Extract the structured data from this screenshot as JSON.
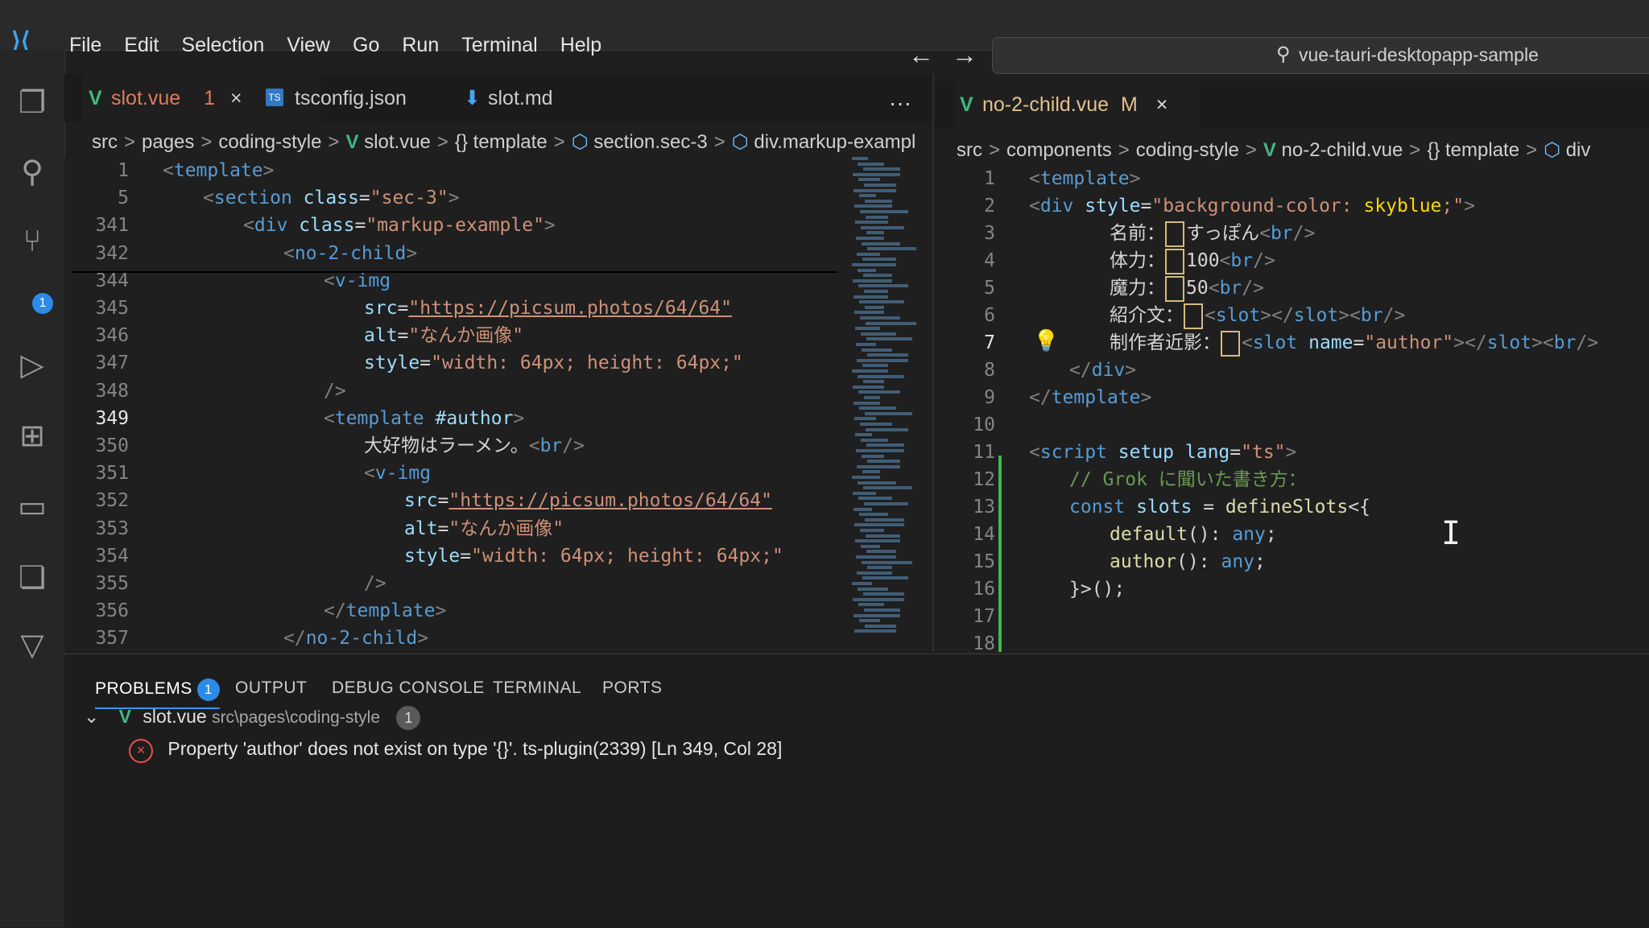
{
  "menu": [
    "File",
    "Edit",
    "Selection",
    "View",
    "Go",
    "Run",
    "Terminal",
    "Help"
  ],
  "nav": {
    "back": "←",
    "forward": "→"
  },
  "search": {
    "text": "vue-tauri-desktopapp-sample"
  },
  "left_tabs": [
    {
      "label": "slot.vue",
      "badge": "1",
      "close": "×",
      "icon": "V"
    },
    {
      "label": "tsconfig.json",
      "icon": "TS"
    },
    {
      "label": "slot.md",
      "icon": "⬇"
    }
  ],
  "more": "···",
  "left_breadcrumb": [
    "src",
    "pages",
    "coding-style",
    "slot.vue",
    "{} template",
    "section.sec-3",
    "div.markup-exampl"
  ],
  "right_tab": {
    "label": "no-2-child.vue",
    "status": "M",
    "close": "×",
    "icon": "V"
  },
  "right_breadcrumb": [
    "src",
    "components",
    "coding-style",
    "no-2-child.vue",
    "{} template",
    "div"
  ],
  "left_lines": [
    {
      "n": "1",
      "ind": 0,
      "segs": [
        [
          "p",
          "<"
        ],
        [
          "t",
          "template"
        ],
        [
          "p",
          ">"
        ]
      ]
    },
    {
      "n": "5",
      "ind": 1,
      "segs": [
        [
          "p",
          "<"
        ],
        [
          "t",
          "section "
        ],
        [
          "a",
          "class"
        ],
        [
          "w",
          "="
        ],
        [
          "s",
          "\"sec-3\""
        ],
        [
          "p",
          ">"
        ]
      ]
    },
    {
      "n": "341",
      "ind": 2,
      "segs": [
        [
          "p",
          "<"
        ],
        [
          "t",
          "div "
        ],
        [
          "a",
          "class"
        ],
        [
          "w",
          "="
        ],
        [
          "s",
          "\"markup-example\""
        ],
        [
          "p",
          ">"
        ]
      ]
    },
    {
      "n": "342",
      "ind": 3,
      "segs": [
        [
          "p",
          "<"
        ],
        [
          "t",
          "no-2-child"
        ],
        [
          "p",
          ">"
        ]
      ]
    },
    {
      "n": "344",
      "ind": 4,
      "segs": [
        [
          "p",
          "<"
        ],
        [
          "t",
          "v-img"
        ]
      ]
    },
    {
      "n": "345",
      "ind": 5,
      "segs": [
        [
          "a",
          "src"
        ],
        [
          "w",
          "="
        ],
        [
          "s",
          "\"https://picsum.photos/64/64\""
        ]
      ]
    },
    {
      "n": "346",
      "ind": 5,
      "segs": [
        [
          "a",
          "alt"
        ],
        [
          "w",
          "="
        ],
        [
          "s",
          "\"なんか画像\""
        ]
      ]
    },
    {
      "n": "347",
      "ind": 5,
      "segs": [
        [
          "a",
          "style"
        ],
        [
          "w",
          "="
        ],
        [
          "s",
          "\"width: 64px; height: 64px;\""
        ]
      ]
    },
    {
      "n": "348",
      "ind": 4,
      "segs": [
        [
          "p",
          "/>"
        ]
      ]
    },
    {
      "n": "349",
      "ind": 4,
      "segs": [
        [
          "p",
          "<"
        ],
        [
          "t",
          "template "
        ],
        [
          "a",
          "#author"
        ],
        [
          "p",
          ">"
        ]
      ]
    },
    {
      "n": "350",
      "ind": 5,
      "segs": [
        [
          "w",
          "大好物はラーメン。"
        ],
        [
          "p",
          "<"
        ],
        [
          "t",
          "br"
        ],
        [
          "p",
          "/>"
        ]
      ]
    },
    {
      "n": "351",
      "ind": 5,
      "segs": [
        [
          "p",
          "<"
        ],
        [
          "t",
          "v-img"
        ]
      ]
    },
    {
      "n": "352",
      "ind": 6,
      "segs": [
        [
          "a",
          "src"
        ],
        [
          "w",
          "="
        ],
        [
          "s",
          "\"https://picsum.photos/64/64\""
        ]
      ]
    },
    {
      "n": "353",
      "ind": 6,
      "segs": [
        [
          "a",
          "alt"
        ],
        [
          "w",
          "="
        ],
        [
          "s",
          "\"なんか画像\""
        ]
      ]
    },
    {
      "n": "354",
      "ind": 6,
      "segs": [
        [
          "a",
          "style"
        ],
        [
          "w",
          "="
        ],
        [
          "s",
          "\"width: 64px; height: 64px;\""
        ]
      ]
    },
    {
      "n": "355",
      "ind": 5,
      "segs": [
        [
          "p",
          "/>"
        ]
      ]
    },
    {
      "n": "356",
      "ind": 4,
      "segs": [
        [
          "p",
          "</"
        ],
        [
          "t",
          "template"
        ],
        [
          "p",
          ">"
        ]
      ]
    },
    {
      "n": "357",
      "ind": 3,
      "segs": [
        [
          "p",
          "</"
        ],
        [
          "t",
          "no-2-child"
        ],
        [
          "p",
          ">"
        ]
      ]
    }
  ],
  "right_lines": [
    {
      "n": "1",
      "ind": 0,
      "segs": [
        [
          "p",
          "<"
        ],
        [
          "t",
          "template"
        ],
        [
          "p",
          ">"
        ]
      ]
    },
    {
      "n": "2",
      "ind": 0,
      "segs": [
        [
          "p",
          "<"
        ],
        [
          "t",
          "div "
        ],
        [
          "a",
          "style"
        ],
        [
          "w",
          "="
        ],
        [
          "s",
          "\"background-color: "
        ],
        [
          "y",
          "skyblue"
        ],
        [
          "s",
          ";\""
        ],
        [
          "p",
          ">"
        ]
      ]
    },
    {
      "n": "3",
      "ind": 2,
      "segs": [
        [
          "w",
          "名前："
        ],
        [
          "box",
          ""
        ],
        [
          "w",
          "すっぽん"
        ],
        [
          "p",
          "<"
        ],
        [
          "t",
          "br"
        ],
        [
          "p",
          "/>"
        ]
      ]
    },
    {
      "n": "4",
      "ind": 2,
      "segs": [
        [
          "w",
          "体力："
        ],
        [
          "box",
          ""
        ],
        [
          "w",
          "100"
        ],
        [
          "p",
          "<"
        ],
        [
          "t",
          "br"
        ],
        [
          "p",
          "/>"
        ]
      ]
    },
    {
      "n": "5",
      "ind": 2,
      "segs": [
        [
          "w",
          "魔力："
        ],
        [
          "box",
          ""
        ],
        [
          "w",
          "50"
        ],
        [
          "p",
          "<"
        ],
        [
          "t",
          "br"
        ],
        [
          "p",
          "/>"
        ]
      ]
    },
    {
      "n": "6",
      "ind": 2,
      "segs": [
        [
          "w",
          "紹介文："
        ],
        [
          "box",
          ""
        ],
        [
          "p",
          "<"
        ],
        [
          "t",
          "slot"
        ],
        [
          "p",
          "></"
        ],
        [
          "t",
          "slot"
        ],
        [
          "p",
          "><"
        ],
        [
          "t",
          "br"
        ],
        [
          "p",
          "/>"
        ]
      ]
    },
    {
      "n": "7",
      "ind": 2,
      "segs": [
        [
          "w",
          "制作者近影："
        ],
        [
          "box",
          ""
        ],
        [
          "p",
          "<"
        ],
        [
          "t",
          "slot "
        ],
        [
          "a",
          "name"
        ],
        [
          "w",
          "="
        ],
        [
          "s",
          "\"author\""
        ],
        [
          "p",
          "></"
        ],
        [
          "t",
          "slot"
        ],
        [
          "p",
          "><"
        ],
        [
          "t",
          "br"
        ],
        [
          "p",
          "/>"
        ]
      ]
    },
    {
      "n": "8",
      "ind": 1,
      "segs": [
        [
          "p",
          "</"
        ],
        [
          "t",
          "div"
        ],
        [
          "p",
          ">"
        ]
      ]
    },
    {
      "n": "9",
      "ind": 0,
      "segs": [
        [
          "p",
          "</"
        ],
        [
          "t",
          "template"
        ],
        [
          "p",
          ">"
        ]
      ]
    },
    {
      "n": "10",
      "ind": 0,
      "segs": []
    },
    {
      "n": "11",
      "ind": 0,
      "segs": [
        [
          "p",
          "<"
        ],
        [
          "t",
          "script "
        ],
        [
          "a",
          "setup "
        ],
        [
          "a",
          "lang"
        ],
        [
          "w",
          "="
        ],
        [
          "s",
          "\"ts\""
        ],
        [
          "p",
          ">"
        ]
      ]
    },
    {
      "n": "12",
      "ind": 1,
      "segs": [
        [
          "c",
          "// Grok に聞いた書き方："
        ]
      ]
    },
    {
      "n": "13",
      "ind": 1,
      "segs": [
        [
          "k",
          "const "
        ],
        [
          "a",
          "slots"
        ],
        [
          "w",
          " = "
        ],
        [
          "f",
          "defineSlots"
        ],
        [
          "w",
          "<{"
        ]
      ]
    },
    {
      "n": "14",
      "ind": 2,
      "segs": [
        [
          "f",
          "default"
        ],
        [
          "w",
          "(): "
        ],
        [
          "k",
          "any"
        ],
        [
          "w",
          ";"
        ]
      ]
    },
    {
      "n": "15",
      "ind": 2,
      "segs": [
        [
          "f",
          "author"
        ],
        [
          "w",
          "(): "
        ],
        [
          "k",
          "any"
        ],
        [
          "w",
          ";"
        ]
      ]
    },
    {
      "n": "16",
      "ind": 1,
      "segs": [
        [
          "w",
          "}>();"
        ]
      ]
    },
    {
      "n": "17",
      "ind": 0,
      "segs": []
    },
    {
      "n": "18",
      "ind": 0,
      "segs": []
    }
  ],
  "panel": {
    "tabs": [
      "PROBLEMS",
      "OUTPUT",
      "DEBUG CONSOLE",
      "TERMINAL",
      "PORTS"
    ],
    "problems_count": "1",
    "file": {
      "name": "slot.vue",
      "path": "src\\pages\\coding-style",
      "count": "1"
    },
    "message": "Property 'author' does not exist on type '{}'. ts-plugin(2339)  [Ln 349, Col 28]"
  },
  "activity_badge": "1"
}
